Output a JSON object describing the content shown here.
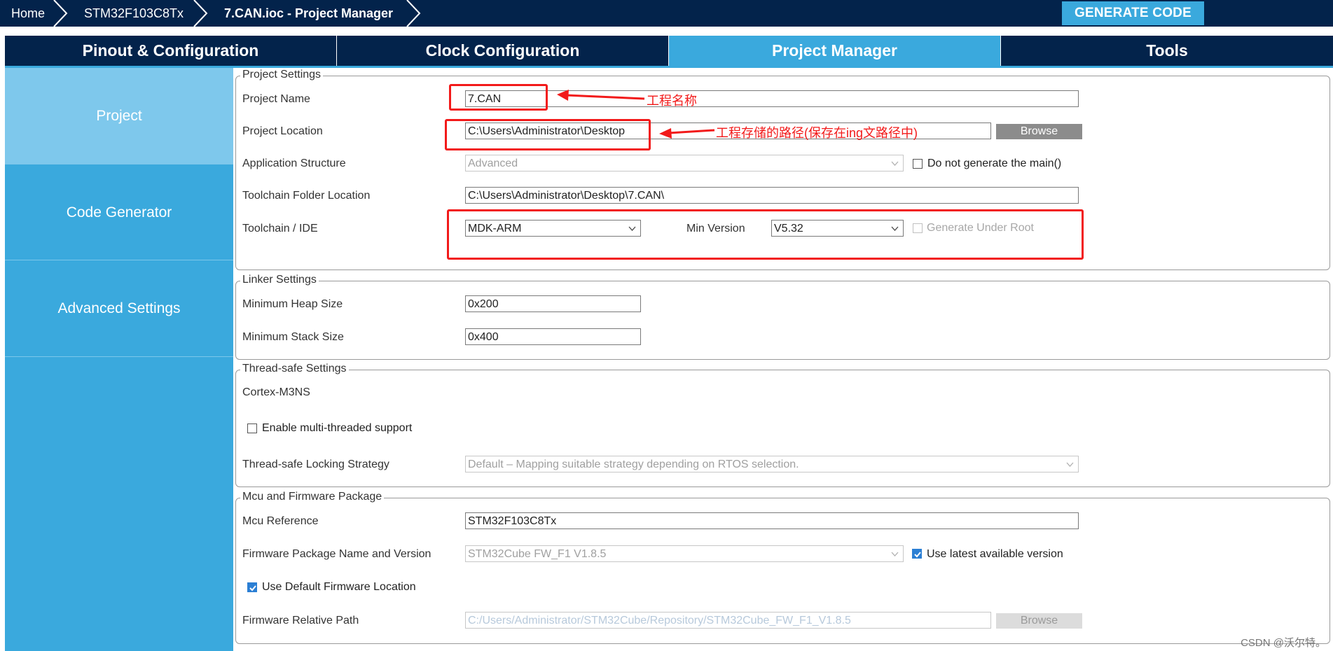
{
  "breadcrumb": {
    "home": "Home",
    "mcu": "STM32F103C8Tx",
    "project": "7.CAN.ioc - Project Manager"
  },
  "generate_button": "GENERATE CODE",
  "tabs": [
    {
      "label": "Pinout & Configuration",
      "active": false
    },
    {
      "label": "Clock Configuration",
      "active": false
    },
    {
      "label": "Project Manager",
      "active": true
    },
    {
      "label": "Tools",
      "active": false
    }
  ],
  "sidebar": {
    "items": [
      {
        "label": "Project",
        "active": true
      },
      {
        "label": "Code Generator",
        "active": false
      },
      {
        "label": "Advanced Settings",
        "active": false
      }
    ]
  },
  "project_settings": {
    "legend": "Project Settings",
    "project_name_label": "Project Name",
    "project_name_value": "7.CAN",
    "project_location_label": "Project Location",
    "project_location_value": "C:\\Users\\Administrator\\Desktop",
    "browse_label": "Browse",
    "app_structure_label": "Application Structure",
    "app_structure_value": "Advanced",
    "do_not_generate_main_label": "Do not generate the main()",
    "do_not_generate_main_checked": false,
    "toolchain_folder_label": "Toolchain Folder Location",
    "toolchain_folder_value": "C:\\Users\\Administrator\\Desktop\\7.CAN\\",
    "toolchain_ide_label": "Toolchain / IDE",
    "toolchain_ide_value": "MDK-ARM",
    "min_version_label": "Min Version",
    "min_version_value": "V5.32",
    "generate_under_root_label": "Generate Under Root",
    "generate_under_root_checked": false
  },
  "linker_settings": {
    "legend": "Linker Settings",
    "heap_label": "Minimum Heap Size",
    "heap_value": "0x200",
    "stack_label": "Minimum Stack Size",
    "stack_value": "0x400"
  },
  "thread_safe": {
    "legend": "Thread-safe Settings",
    "core": "Cortex-M3NS",
    "multithread_label": "Enable multi-threaded support",
    "multithread_checked": false,
    "locking_label": "Thread-safe Locking Strategy",
    "locking_value": "Default  –  Mapping suitable strategy depending on RTOS selection."
  },
  "mcu_firmware": {
    "legend": "Mcu and Firmware Package",
    "mcu_ref_label": "Mcu Reference",
    "mcu_ref_value": "STM32F103C8Tx",
    "fw_label": "Firmware Package Name and Version",
    "fw_value": "STM32Cube FW_F1 V1.8.5",
    "use_latest_label": "Use latest available version",
    "use_latest_checked": true,
    "use_default_fw_label": "Use Default Firmware Location",
    "use_default_fw_checked": true,
    "fw_path_label": "Firmware Relative Path",
    "fw_path_value": "C:/Users/Administrator/STM32Cube/Repository/STM32Cube_FW_F1_V1.8.5",
    "browse_label": "Browse"
  },
  "annotations": {
    "name_note": "工程名称",
    "location_note": "工程存储的路径(保存在ing文路径中)",
    "color": "#f21a1a"
  },
  "watermark": "CSDN @沃尔特。",
  "colors": {
    "navy": "#03234b",
    "accent": "#3aa9dd",
    "sidebar_active": "#7ec8ec"
  }
}
